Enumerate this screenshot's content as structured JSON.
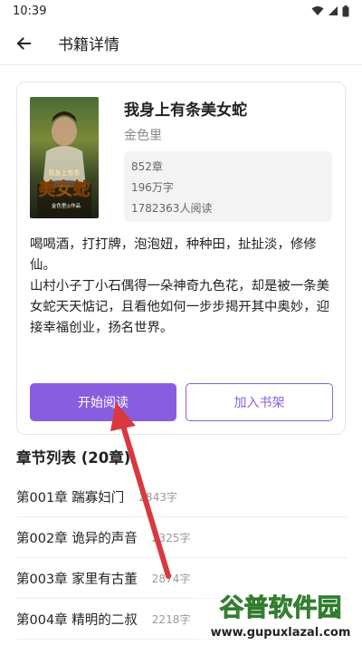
{
  "status_bar": {
    "time": "10:39"
  },
  "app_bar": {
    "title": "书籍详情"
  },
  "book": {
    "cover_text_1": "我身上有条",
    "cover_text_2": "美女蛇",
    "cover_text_3": "金色里◎作品",
    "title": "我身上有条美女蛇",
    "author": "金色里",
    "stats": {
      "chapters": "852章",
      "words": "196万字",
      "readers": "1782363人阅读"
    },
    "description": "喝喝酒，打打牌，泡泡妞，种种田，扯扯淡，修修仙。\n山村小子丁小石偶得一朵神奇九色花，却是被一条美女蛇天天惦记，且看他如何一步步揭开其中奥妙，迎接幸福创业，扬名世界。"
  },
  "actions": {
    "start_label": "开始阅读",
    "shelf_label": "加入书架"
  },
  "chapters": {
    "header": "章节列表 (20章)",
    "items": [
      {
        "title": "第001章 踹寡妇门",
        "words": "2843字"
      },
      {
        "title": "第002章 诡异的声音",
        "words": "2325字"
      },
      {
        "title": "第003章 家里有古董",
        "words": "2874字"
      },
      {
        "title": "第004章 精明的二叔",
        "words": "2218字"
      }
    ]
  },
  "watermark": {
    "brand": "谷普软件园",
    "url": "www.gupuxlazal.com"
  },
  "colors": {
    "accent": "#8a5de0",
    "arrow": "#d8383e"
  }
}
